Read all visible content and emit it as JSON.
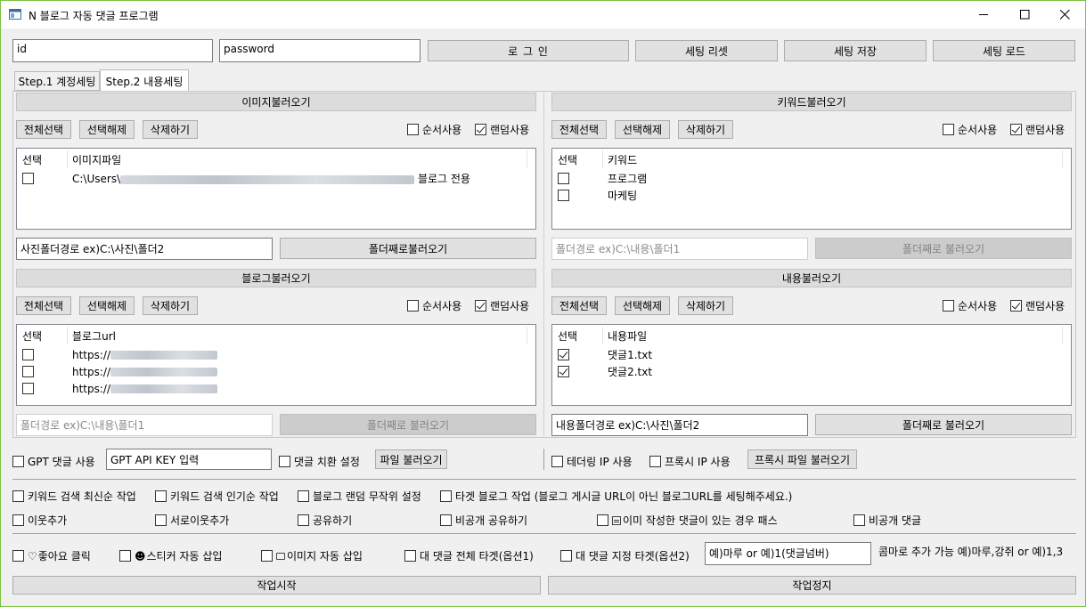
{
  "window": {
    "title": "N 블로그 자동 댓글 프로그램"
  },
  "login": {
    "id_value": "id",
    "password_value": "password",
    "login_label": "로 그 인",
    "reset_label": "세팅 리셋",
    "save_label": "세팅 저장",
    "load_label": "세팅 로드"
  },
  "tabs": [
    {
      "label": "Step.1 계정세팅",
      "active": false
    },
    {
      "label": "Step.2 내용세팅",
      "active": true
    }
  ],
  "common": {
    "select_all": "전체선택",
    "deselect": "선택해제",
    "delete": "삭제하기",
    "order_use": "순서사용",
    "random_use": "랜덤사용",
    "select_col": "선택"
  },
  "image_section": {
    "header": "이미지불러오기",
    "col2": "이미지파일",
    "order_checked": false,
    "random_checked": true,
    "rows": [
      {
        "checked": false,
        "prefix": "C:\\Users\\",
        "suffix": " 블로그 전용"
      }
    ],
    "path_value": "사진폴더경로 ex)C:\\사진\\폴더2",
    "load_button": "폴더째로불러오기"
  },
  "keyword_section": {
    "header": "키워드불러오기",
    "col2": "키워드",
    "order_checked": false,
    "random_checked": true,
    "rows": [
      {
        "checked": false,
        "text": "프로그램"
      },
      {
        "checked": false,
        "text": "마케팅"
      }
    ],
    "path_placeholder": "폴더경로 ex)C:\\내용\\폴더1",
    "load_button": "폴더째로 불러오기"
  },
  "blog_section": {
    "header": "블로그불러오기",
    "col2": "블로그url",
    "order_checked": false,
    "random_checked": true,
    "rows": [
      {
        "checked": false,
        "prefix": "https://"
      },
      {
        "checked": false,
        "prefix": "https://"
      },
      {
        "checked": false,
        "prefix": "https://"
      }
    ],
    "path_placeholder": "폴더경로 ex)C:\\내용\\폴더1",
    "load_button": "폴더째로 불러오기"
  },
  "content_section": {
    "header": "내용불러오기",
    "col2": "내용파일",
    "order_checked": false,
    "random_checked": true,
    "rows": [
      {
        "checked": true,
        "text": "댓글1.txt"
      },
      {
        "checked": true,
        "text": "댓글2.txt"
      }
    ],
    "path_value": "내용폴더경로 ex)C:\\사진\\폴더2",
    "load_button": "폴더째로 불러오기"
  },
  "gpt": {
    "use_label": "GPT 댓글 사용",
    "api_key_value": "GPT API KEY 입력",
    "replace_label": "댓글 치환 설정",
    "file_load": "파일 불러오기",
    "tethering": "테더링 IP 사용",
    "proxy": "프록시 IP 사용",
    "proxy_file": "프록시 파일 불러오기"
  },
  "options_row1": [
    "키워드 검색 최신순 작업",
    "키워드 검색 인기순 작업",
    "블로그 랜덤 무작위 설정",
    "타겟 블로그 작업 (블로그 게시글 URL이 아닌 블로그URL를 세팅해주세요.)"
  ],
  "options_row2": [
    "이웃추가",
    "서로이웃추가",
    "공유하기",
    "비공개 공유하기",
    "이미 작성한 댓글이 있는 경우 패스",
    "비공개 댓글"
  ],
  "options_row3": [
    "좋아요 클릭",
    "스티커 자동 삽입",
    "이미지 자동 삽입",
    "대 댓글 전체 타겟(옵션1)",
    "대 댓글 지정 타겟(옵션2)"
  ],
  "reply_target": {
    "value": "예)마루 or 예)1(댓글넘버)",
    "hint": "콤마로 추가 가능 예)마루,강쥐 or 예)1,3"
  },
  "actions": {
    "start": "작업시작",
    "stop": "작업정지"
  }
}
